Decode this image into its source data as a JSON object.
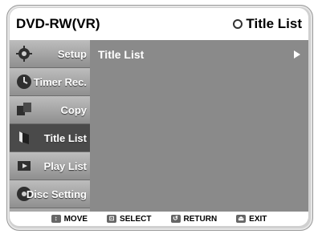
{
  "header": {
    "device": "DVD-RW(VR)",
    "section": "Title List"
  },
  "sidebar": {
    "items": [
      {
        "label": "Setup",
        "icon": "gear-icon"
      },
      {
        "label": "Timer Rec.",
        "icon": "clock-icon"
      },
      {
        "label": "Copy",
        "icon": "copy-icon"
      },
      {
        "label": "Title List",
        "icon": "title-list-icon",
        "active": true
      },
      {
        "label": "Play List",
        "icon": "play-list-icon"
      },
      {
        "label": "Disc Setting",
        "icon": "disc-icon"
      }
    ]
  },
  "main": {
    "title": "Title List"
  },
  "footer": {
    "move": "MOVE",
    "select": "SELECT",
    "return": "RETURN",
    "exit": "EXIT"
  }
}
